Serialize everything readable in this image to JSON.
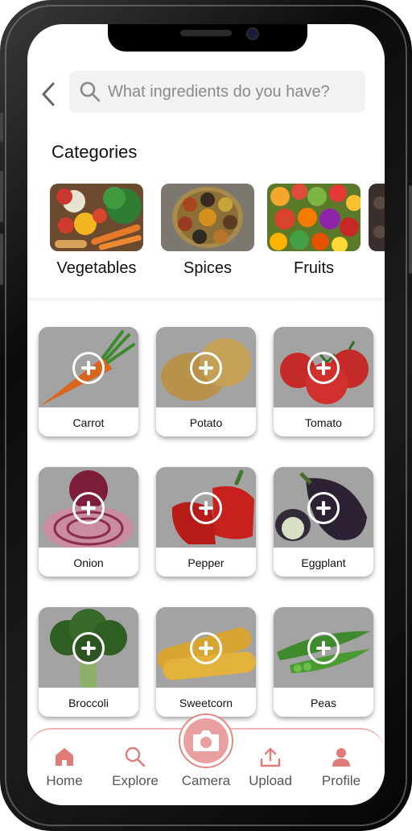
{
  "header": {
    "search_placeholder": "What ingredients do you have?"
  },
  "categories": {
    "title": "Categories",
    "items": [
      {
        "label": "Vegetables"
      },
      {
        "label": "Spices"
      },
      {
        "label": "Fruits"
      },
      {
        "label": ""
      }
    ]
  },
  "ingredients": [
    {
      "label": "Carrot"
    },
    {
      "label": "Potato"
    },
    {
      "label": "Tomato"
    },
    {
      "label": "Onion"
    },
    {
      "label": "Pepper"
    },
    {
      "label": "Eggplant"
    },
    {
      "label": "Broccoli"
    },
    {
      "label": "Sweetcorn"
    },
    {
      "label": "Peas"
    }
  ],
  "nav": {
    "items": [
      {
        "label": "Home",
        "icon": "home-icon"
      },
      {
        "label": "Explore",
        "icon": "search-icon"
      },
      {
        "label": "Camera",
        "icon": "camera-icon"
      },
      {
        "label": "Upload",
        "icon": "upload-icon"
      },
      {
        "label": "Profile",
        "icon": "person-icon"
      }
    ]
  },
  "colors": {
    "accent": "#e07b7b",
    "accent_light": "#eeb3b3",
    "card_overlay": "#9c9c9c",
    "search_bg": "#f2f2f2"
  }
}
